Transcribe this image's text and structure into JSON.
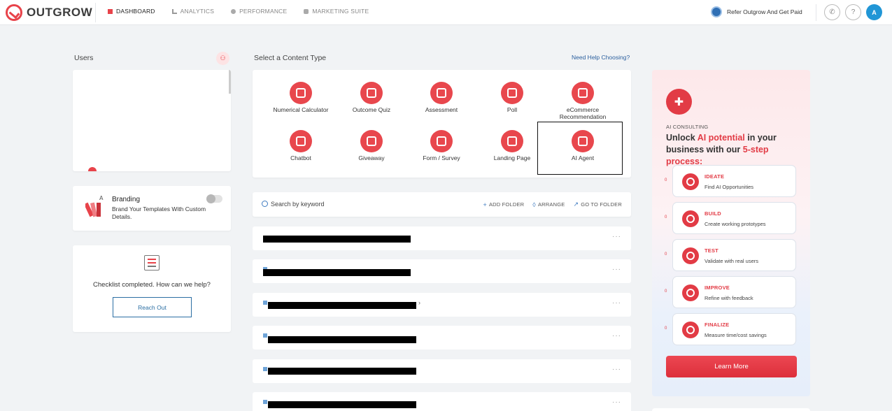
{
  "brand": {
    "name": "OUTGROW"
  },
  "nav": {
    "items": [
      {
        "label": "DASHBOARD"
      },
      {
        "label": "ANALYTICS"
      },
      {
        "label": "PERFORMANCE"
      },
      {
        "label": "MARKETING SUITE"
      }
    ],
    "refer_label": "Refer Outgrow And Get Paid",
    "help_label": "?",
    "avatar_initial": "A"
  },
  "users": {
    "title": "Users"
  },
  "branding": {
    "title": "Branding",
    "description": "Brand Your Templates With Custom Details.",
    "enabled": false
  },
  "checklist": {
    "message": "Checklist completed. How can we help?",
    "button_label": "Reach Out"
  },
  "content_type": {
    "title": "Select a Content Type",
    "help_link": "Need Help Choosing?",
    "types": [
      {
        "label": "Numerical Calculator",
        "icon": "calculator-icon"
      },
      {
        "label": "Outcome Quiz",
        "icon": "grid-icon"
      },
      {
        "label": "Assessment",
        "icon": "bar-chart-icon"
      },
      {
        "label": "Poll",
        "icon": "thumbs-up-icon"
      },
      {
        "label": "eCommerce Recommendation",
        "icon": "cart-icon"
      },
      {
        "label": "Chatbot",
        "icon": "chat-icon"
      },
      {
        "label": "Giveaway",
        "icon": "trophy-icon"
      },
      {
        "label": "Form / Survey",
        "icon": "clipboard-icon"
      },
      {
        "label": "Landing Page",
        "icon": "layout-icon"
      },
      {
        "label": "AI Agent",
        "icon": "robot-icon"
      }
    ]
  },
  "search": {
    "placeholder": "Search by keyword",
    "add_folder": "ADD FOLDER",
    "arrange": "ARRANGE",
    "go_to_folder": "GO TO FOLDER"
  },
  "rows": {
    "more_label": "···",
    "chevron": "›"
  },
  "ai_consulting": {
    "eyebrow": "AI CONSULTING",
    "headline_1": "Unlock ",
    "headline_hl1": "AI potential",
    "headline_2": " in your business with our ",
    "headline_hl2": "5-step process:",
    "steps": [
      {
        "title": "IDEATE",
        "desc": "Find AI Opportunities"
      },
      {
        "title": "BUILD",
        "desc": "Create working prototypes"
      },
      {
        "title": "TEST",
        "desc": "Validate with real users"
      },
      {
        "title": "IMPROVE",
        "desc": "Refine with feedback"
      },
      {
        "title": "FINALIZE",
        "desc": "Measure time/cost savings"
      }
    ],
    "step_markers": [
      "0",
      "0",
      "0",
      "0",
      "0"
    ],
    "button_label": "Learn More"
  },
  "colors": {
    "accent": "#e8434a",
    "link": "#2b5f9e",
    "background": "#f1f3f5"
  }
}
